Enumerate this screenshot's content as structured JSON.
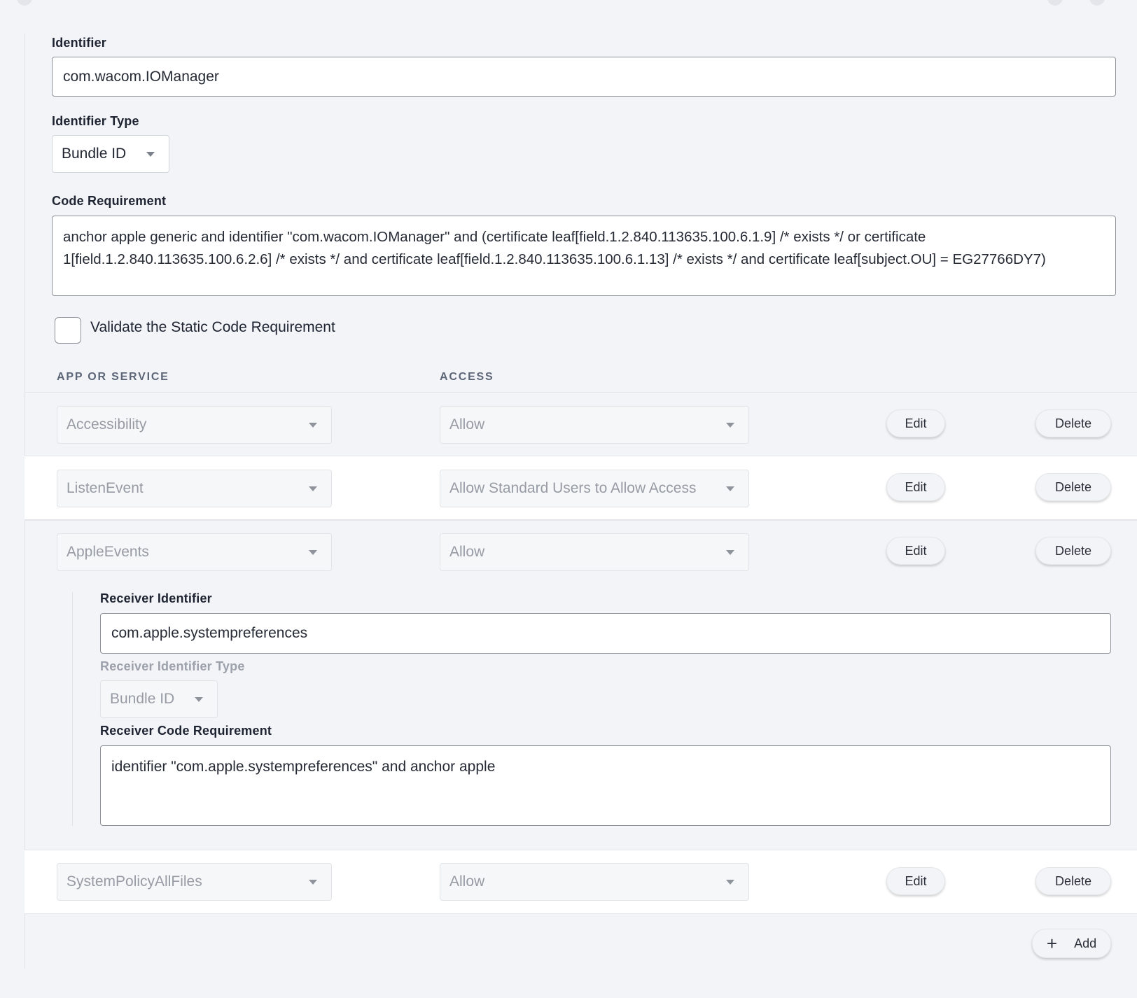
{
  "form": {
    "identifier_label": "Identifier",
    "identifier_value": "com.wacom.IOManager",
    "identifier_type_label": "Identifier Type",
    "identifier_type_value": "Bundle ID",
    "code_requirement_label": "Code Requirement",
    "code_requirement_value": "anchor apple generic and identifier \"com.wacom.IOManager\" and (certificate leaf[field.1.2.840.113635.100.6.1.9] /* exists */ or certificate 1[field.1.2.840.113635.100.6.2.6] /* exists */ and certificate leaf[field.1.2.840.113635.100.6.1.13] /* exists */ and certificate leaf[subject.OU] = EG27766DY7)",
    "validate_label": "Validate the Static Code Requirement",
    "validate_checked": false
  },
  "table": {
    "col_app": "APP OR SERVICE",
    "col_access": "ACCESS",
    "edit_label": "Edit",
    "delete_label": "Delete",
    "rows": [
      {
        "service": "Accessibility",
        "access": "Allow"
      },
      {
        "service": "ListenEvent",
        "access": "Allow Standard Users to Allow Access"
      },
      {
        "service": "AppleEvents",
        "access": "Allow"
      },
      {
        "service": "SystemPolicyAllFiles",
        "access": "Allow"
      }
    ],
    "receiver": {
      "identifier_label": "Receiver Identifier",
      "identifier_value": "com.apple.systempreferences",
      "identifier_type_label": "Receiver Identifier Type",
      "identifier_type_value": "Bundle ID",
      "code_requirement_label": "Receiver Code Requirement",
      "code_requirement_value": "identifier \"com.apple.systempreferences\" and anchor apple"
    },
    "add_label": "Add"
  }
}
